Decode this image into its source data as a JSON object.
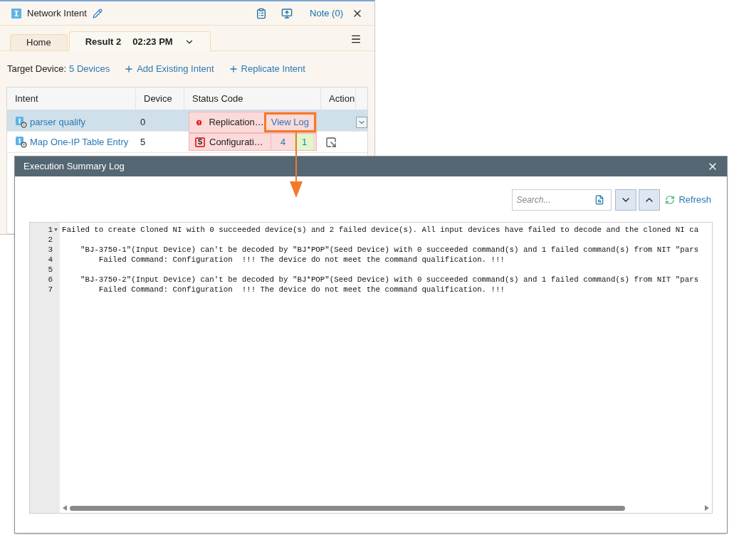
{
  "panel": {
    "title": "Network Intent",
    "note": "Note (0)"
  },
  "tabs": [
    {
      "label": "Home",
      "selected": false
    },
    {
      "label": "Result 2",
      "time": "02:23 PM",
      "selected": true
    }
  ],
  "toolbar": {
    "target_label": "Target Device:",
    "target_value": "5 Devices",
    "actions": [
      "Add Existing Intent",
      "Replicate Intent"
    ]
  },
  "table": {
    "columns": [
      "Intent",
      "Device",
      "Status Code",
      "Action"
    ],
    "rows": [
      {
        "intent": "parser qualify",
        "device": "0",
        "kind": "error",
        "status": "Replication…",
        "link": "View Log",
        "selected": true
      },
      {
        "intent": "Map One-IP Table Entry",
        "device": "5",
        "kind": "counts",
        "badge": "S",
        "status": "Configurati…",
        "fail_count": "4",
        "pass_count": "1",
        "selected": false
      }
    ]
  },
  "dialog": {
    "title": "Execution Summary Log",
    "search_placeholder": "Search...",
    "refresh": "Refresh",
    "lines": [
      {
        "number": "1",
        "text": "Failed to create Cloned NI with 0 succeeded device(s) and 2 failed device(s). All input devices have failed to decode and the cloned NI ca",
        "foldable": true
      },
      {
        "number": "2",
        "foldable": false
      },
      {
        "number": "3",
        "text": "    \"BJ-3750-1\"(Input Device) can't be decoded by \"BJ*POP\"(Seed Device) with 0 succeeded command(s) and 1 failed command(s) from NIT \"pars",
        "foldable": false
      },
      {
        "number": "4",
        "text": "        Failed Command: Configuration  !!! The device do not meet the command qualification. !!!",
        "foldable": false
      },
      {
        "number": "5",
        "foldable": false
      },
      {
        "number": "6",
        "text": "    \"BJ-3750-2\"(Input Device) can't be decoded by \"BJ*POP\"(Seed Device) with 0 succeeded command(s) and 1 failed command(s) from NIT \"pars",
        "foldable": false
      },
      {
        "number": "7",
        "text": "        Failed Command: Configuration  !!! The device do not meet the command qualification. !!!",
        "foldable": false
      }
    ]
  }
}
